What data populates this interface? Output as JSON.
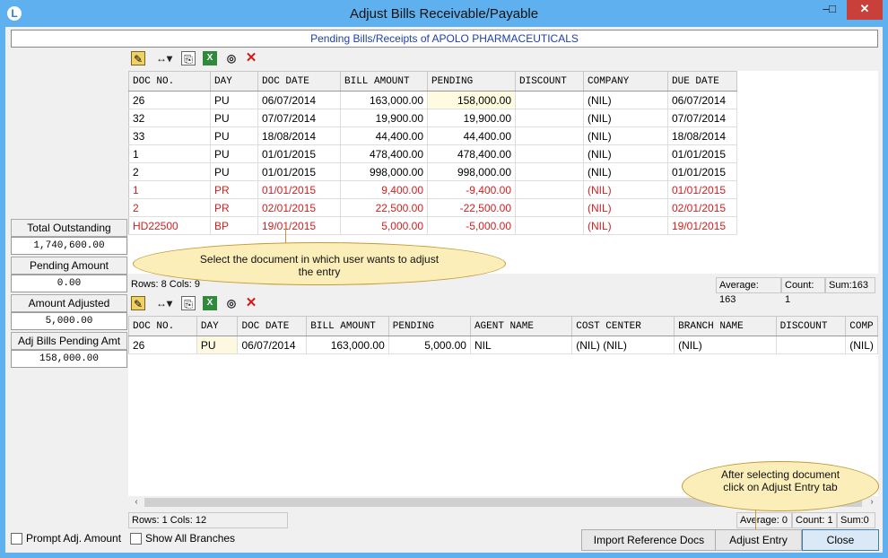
{
  "window": {
    "title": "Adjust Bills Receivable/Payable",
    "app_icon_glyph": "L"
  },
  "header": {
    "text": "Pending Bills/Receipts of APOLO PHARMACEUTICALS"
  },
  "top_grid": {
    "columns": [
      "DOC NO.",
      "DAY",
      "DOC DATE",
      "BILL AMOUNT",
      "PENDING",
      "DISCOUNT",
      "COMPANY",
      "DUE DATE"
    ],
    "rows": [
      {
        "doc_no": "26",
        "day": "PU",
        "doc_date": "06/07/2014",
        "bill_amount": "163,000.00",
        "pending": "158,000.00",
        "discount": "",
        "company": "(NIL)",
        "due_date": "06/07/2014",
        "red": false
      },
      {
        "doc_no": "32",
        "day": "PU",
        "doc_date": "07/07/2014",
        "bill_amount": "19,900.00",
        "pending": "19,900.00",
        "discount": "",
        "company": "(NIL)",
        "due_date": "07/07/2014",
        "red": false
      },
      {
        "doc_no": "33",
        "day": "PU",
        "doc_date": "18/08/2014",
        "bill_amount": "44,400.00",
        "pending": "44,400.00",
        "discount": "",
        "company": "(NIL)",
        "due_date": "18/08/2014",
        "red": false
      },
      {
        "doc_no": "1",
        "day": "PU",
        "doc_date": "01/01/2015",
        "bill_amount": "478,400.00",
        "pending": "478,400.00",
        "discount": "",
        "company": "(NIL)",
        "due_date": "01/01/2015",
        "red": false
      },
      {
        "doc_no": "2",
        "day": "PU",
        "doc_date": "01/01/2015",
        "bill_amount": "998,000.00",
        "pending": "998,000.00",
        "discount": "",
        "company": "(NIL)",
        "due_date": "01/01/2015",
        "red": false
      },
      {
        "doc_no": "1",
        "day": "PR",
        "doc_date": "01/01/2015",
        "bill_amount": "9,400.00",
        "pending": "-9,400.00",
        "discount": "",
        "company": "(NIL)",
        "due_date": "01/01/2015",
        "red": true
      },
      {
        "doc_no": "2",
        "day": "PR",
        "doc_date": "02/01/2015",
        "bill_amount": "22,500.00",
        "pending": "-22,500.00",
        "discount": "",
        "company": "(NIL)",
        "due_date": "02/01/2015",
        "red": true
      },
      {
        "doc_no": "HD22500",
        "day": "BP",
        "doc_date": "19/01/2015",
        "bill_amount": "5,000.00",
        "pending": "-5,000.00",
        "discount": "",
        "company": "(NIL)",
        "due_date": "19/01/2015",
        "red": true
      }
    ],
    "status": {
      "rows_cols": "Rows: 8  Cols: 9",
      "average": "Average: 163",
      "count": "Count: 1",
      "sum": "Sum:163"
    }
  },
  "bottom_grid": {
    "columns": [
      "DOC NO.",
      "DAY",
      "DOC DATE",
      "BILL AMOUNT",
      "PENDING",
      "AGENT NAME",
      "COST CENTER",
      "BRANCH NAME",
      "DISCOUNT",
      "COMP"
    ],
    "rows": [
      {
        "doc_no": "26",
        "day": "PU",
        "doc_date": "06/07/2014",
        "bill_amount": "163,000.00",
        "pending": "5,000.00",
        "agent_name": "NIL",
        "cost_center": "(NIL) (NIL)",
        "branch_name": "(NIL)",
        "discount": "",
        "comp": "(NIL)"
      }
    ],
    "status": {
      "rows_cols": "Rows: 1  Cols: 12",
      "average": "Average: 0",
      "count": "Count: 1",
      "sum": "Sum:0"
    }
  },
  "sidebar": {
    "total_outstanding_label": "Total Outstanding",
    "total_outstanding_value": "1,740,600.00",
    "pending_amount_label": "Pending Amount",
    "pending_amount_value": "0.00",
    "amount_adjusted_label": "Amount Adjusted",
    "amount_adjusted_value": "5,000.00",
    "adj_bills_pending_label": "Adj Bills Pending Amt",
    "adj_bills_pending_value": "158,000.00"
  },
  "callouts": {
    "select_doc": "Select the document in which user wants to adjust the entry",
    "adjust_entry": "After selecting document click on Adjust Entry tab"
  },
  "footer": {
    "prompt_adj_label": "Prompt Adj. Amount",
    "show_branches_label": "Show All Branches",
    "import_button": "Import Reference Docs",
    "adjust_button": "Adjust Entry",
    "close_button": "Close"
  }
}
